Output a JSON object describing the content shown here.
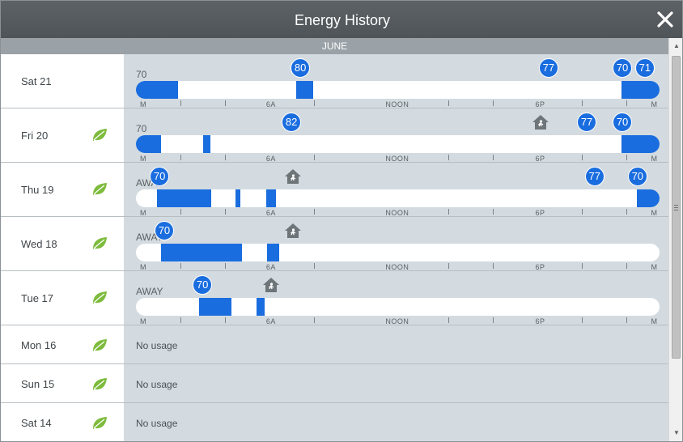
{
  "window": {
    "title": "Energy History",
    "close_icon": "close-icon"
  },
  "month": "JUNE",
  "tick_labels": [
    {
      "label": "M",
      "pos": 0.014
    },
    {
      "label": "6A",
      "pos": 0.258
    },
    {
      "label": "NOON",
      "pos": 0.499
    },
    {
      "label": "6P",
      "pos": 0.772
    },
    {
      "label": "M",
      "pos": 0.99
    }
  ],
  "tick_marks": [
    0.085,
    0.17,
    0.34,
    0.597,
    0.682,
    0.852,
    0.937
  ],
  "no_usage_text": "No usage",
  "colors": {
    "accent": "#1a6ddf",
    "leaf": "#7dbb3c",
    "title_bar": "#54595d",
    "row_bg": "#d3dbe0"
  },
  "days": [
    {
      "label": "Sat 21",
      "leaf": false,
      "start_label": "70",
      "segments": [
        [
          0,
          0.08
        ],
        [
          0.306,
          0.339
        ],
        [
          0.928,
          1
        ]
      ],
      "badges": [
        {
          "v": "80",
          "pos": 0.314
        },
        {
          "v": "77",
          "pos": 0.788
        },
        {
          "v": "70",
          "pos": 0.929
        },
        {
          "v": "71",
          "pos": 0.972
        }
      ],
      "away_home": null
    },
    {
      "label": "Fri 20",
      "leaf": true,
      "start_label": "70",
      "segments": [
        [
          0,
          0.048
        ],
        [
          0.128,
          0.142
        ],
        [
          0.928,
          1
        ]
      ],
      "badges": [
        {
          "v": "82",
          "pos": 0.297
        },
        {
          "v": "77",
          "pos": 0.861
        },
        {
          "v": "70",
          "pos": 0.929
        }
      ],
      "away_home": 0.773
    },
    {
      "label": "Thu 19",
      "leaf": true,
      "start_label": "AWAY",
      "segments": [
        [
          0.04,
          0.143
        ],
        [
          0.19,
          0.2
        ],
        [
          0.249,
          0.268
        ],
        [
          0.957,
          1
        ]
      ],
      "badges": [
        {
          "v": "70",
          "pos": 0.045
        },
        {
          "v": "77",
          "pos": 0.876
        },
        {
          "v": "70",
          "pos": 0.958
        }
      ],
      "away_home": 0.3
    },
    {
      "label": "Wed 18",
      "leaf": true,
      "start_label": "AWAY",
      "segments": [
        [
          0.048,
          0.203
        ],
        [
          0.251,
          0.274
        ]
      ],
      "badges": [
        {
          "v": "70",
          "pos": 0.054
        }
      ],
      "away_home": 0.3
    },
    {
      "label": "Tue 17",
      "leaf": true,
      "start_label": "AWAY",
      "segments": [
        [
          0.12,
          0.183
        ],
        [
          0.23,
          0.246
        ]
      ],
      "badges": [
        {
          "v": "70",
          "pos": 0.127
        }
      ],
      "away_home": 0.258
    },
    {
      "label": "Mon 16",
      "leaf": true,
      "no_usage": true
    },
    {
      "label": "Sun 15",
      "leaf": true,
      "no_usage": true
    },
    {
      "label": "Sat 14",
      "leaf": true,
      "no_usage": true
    }
  ]
}
